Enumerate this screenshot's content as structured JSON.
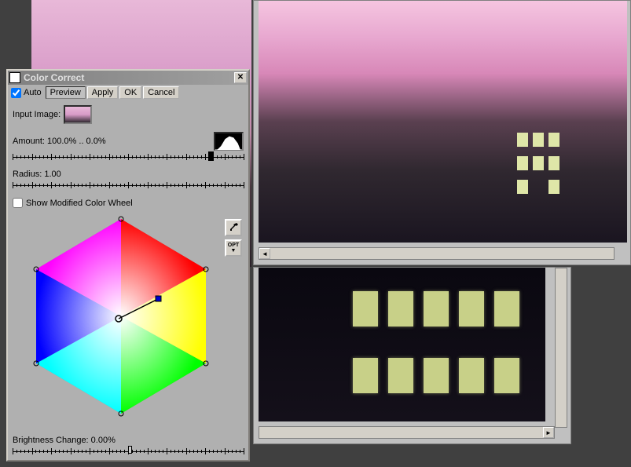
{
  "dialog": {
    "title": "Color Correct",
    "auto_checkbox_label": "Auto",
    "auto_checked": true,
    "buttons": {
      "preview": "Preview",
      "apply": "Apply",
      "ok": "OK",
      "cancel": "Cancel"
    },
    "input_image_label": "Input Image:",
    "amount_label": "Amount: 100.0% .. 0.0%",
    "radius_label": "Radius: 1.00",
    "show_modified_label": "Show Modified Color Wheel",
    "show_modified_checked": false,
    "brightness_label": "Brightness Change: 0.00%",
    "opt_button": "OPT"
  }
}
